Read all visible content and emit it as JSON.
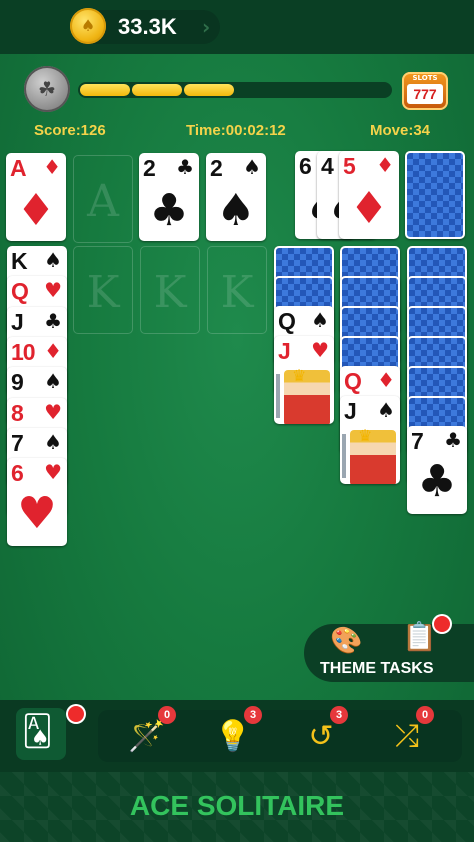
{
  "header": {
    "coins": "33.3K",
    "coin_symbol": "♠"
  },
  "progress": {
    "filled_segments": 3,
    "total_segments": 6,
    "slots_label": "SLOTS",
    "slots_value": "777"
  },
  "stats": {
    "score": "Score:126",
    "time": "Time:00:02:12",
    "moves": "Move:34"
  },
  "foundations": [
    {
      "rank": "A",
      "suit": "♦",
      "color": "red"
    },
    {
      "placeholder": "A"
    },
    {
      "rank": "2",
      "suit": "♣",
      "color": "black"
    },
    {
      "rank": "2",
      "suit": "♠",
      "color": "black"
    }
  ],
  "waste": [
    {
      "rank": "6",
      "suit": "♠",
      "color": "black"
    },
    {
      "rank": "4",
      "suit": "♠",
      "color": "black"
    },
    {
      "rank": "5",
      "suit": "♦",
      "color": "red"
    }
  ],
  "empty_columns_label": "K",
  "column1": [
    {
      "rank": "K",
      "suit": "♠",
      "color": "black"
    },
    {
      "rank": "Q",
      "suit": "♥",
      "color": "red"
    },
    {
      "rank": "J",
      "suit": "♣",
      "color": "black"
    },
    {
      "rank": "10",
      "suit": "♦",
      "color": "red"
    },
    {
      "rank": "9",
      "suit": "♠",
      "color": "black"
    },
    {
      "rank": "8",
      "suit": "♥",
      "color": "red"
    },
    {
      "rank": "7",
      "suit": "♠",
      "color": "black"
    },
    {
      "rank": "6",
      "suit": "♥",
      "color": "red"
    }
  ],
  "column5": [
    {
      "rank": "Q",
      "suit": "♠",
      "color": "black"
    },
    {
      "rank": "J",
      "suit": "♥",
      "color": "red"
    }
  ],
  "column6": [
    {
      "rank": "Q",
      "suit": "♦",
      "color": "red"
    },
    {
      "rank": "J",
      "suit": "♠",
      "color": "black"
    }
  ],
  "column7": [
    {
      "rank": "7",
      "suit": "♣",
      "color": "black"
    }
  ],
  "theme_tasks": {
    "label": "THEME TASKS"
  },
  "tools": {
    "magic_count": "0",
    "hint_count": "3",
    "undo_count": "3",
    "shuffle_count": "0"
  },
  "footer": {
    "title": "ACE SOLITAIRE"
  },
  "colors": {
    "felt": "#167a3f",
    "card_red": "#e0232e",
    "card_back": "#2357b8",
    "accent_gold": "#f4d34a"
  }
}
